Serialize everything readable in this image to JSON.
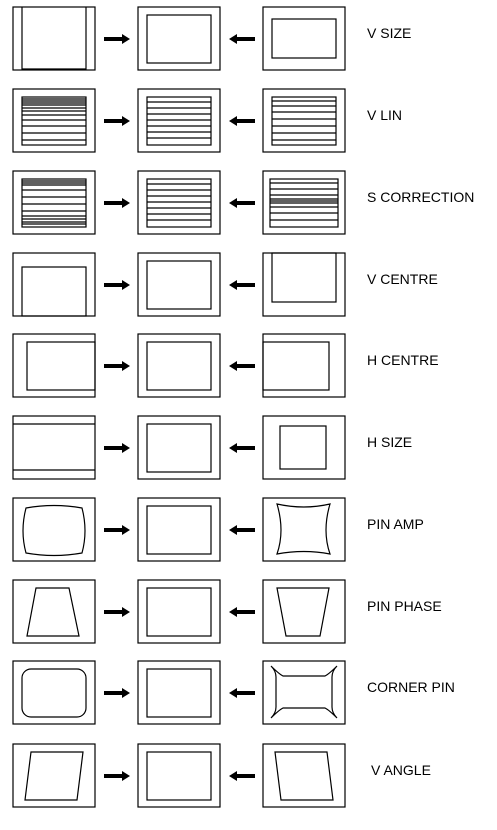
{
  "rows": [
    {
      "id": "v-size",
      "label": "V SIZE",
      "before": "v-size-before",
      "after": "v-size-after"
    },
    {
      "id": "v-lin",
      "label": "V LIN",
      "before": "v-lin-before",
      "after": "v-lin-after"
    },
    {
      "id": "s-correction",
      "label": "S CORRECTION",
      "before": "s-corr-before",
      "after": "s-corr-after"
    },
    {
      "id": "v-centre",
      "label": "V CENTRE",
      "before": "v-centre-before",
      "after": "v-centre-after"
    },
    {
      "id": "h-centre",
      "label": "H CENTRE",
      "before": "h-centre-before",
      "after": "h-centre-after"
    },
    {
      "id": "h-size",
      "label": "H SIZE",
      "before": "h-size-before",
      "after": "h-size-after"
    },
    {
      "id": "pin-amp",
      "label": "PIN AMP",
      "before": "barrel",
      "after": "pincushion"
    },
    {
      "id": "pin-phase",
      "label": "PIN PHASE",
      "before": "trapezoid-wide-bottom",
      "after": "trapezoid-wide-top"
    },
    {
      "id": "corner-pin",
      "label": "CORNER PIN",
      "before": "rounded-corners",
      "after": "flared-corners"
    },
    {
      "id": "v-angle",
      "label": "V ANGLE",
      "before": "skew-right",
      "after": "skew-left"
    }
  ],
  "colors": {
    "line": "#000000",
    "background": "#ffffff"
  }
}
